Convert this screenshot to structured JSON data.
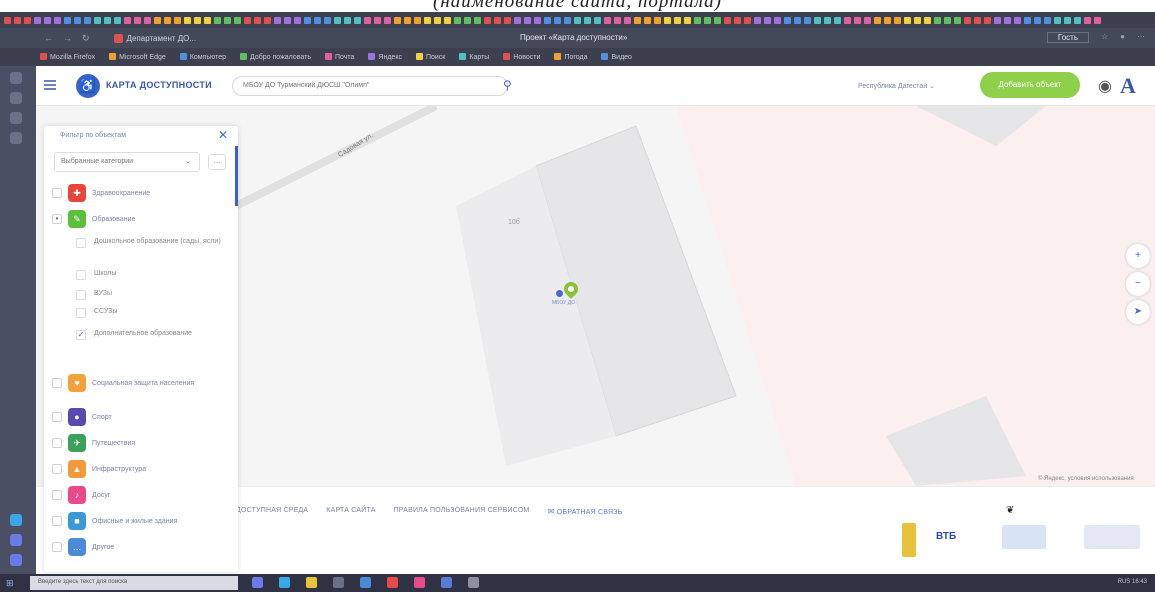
{
  "caption": "(наименование сайта, портала)",
  "browser": {
    "tab_title": "Департамент ДО...",
    "page_title": "Проект «Карта доступности»",
    "profile_label": "Гость",
    "bookmarks": [
      "Mozilla Firefox",
      "Microsoft Edge",
      "Компьютер",
      "Добро пожаловать",
      "Почта",
      "Яндекс",
      "Поиск",
      "Карты",
      "Новости",
      "Погода",
      "Видео"
    ]
  },
  "header": {
    "logo_text": "КАРТА ДОСТУПНОСТИ",
    "search_value": "МБОУ ДО Турманский ДЮСШ \"Олимп\"",
    "region": "Республика Дагестан",
    "add_button": "Добавить объект"
  },
  "map": {
    "street_label": "Садовая ул.",
    "building_number": "10б",
    "poi_label": "МБОУ ДО",
    "copyright": "© Яндекс, условия использования"
  },
  "panel": {
    "title": "Фильтр по объектам",
    "select_value": "Выбранные категории",
    "categories": [
      {
        "label": "Здравоохранение",
        "color": "#e8453c",
        "icon": "✚",
        "checked": false
      },
      {
        "label": "Образование",
        "color": "#5cbf3a",
        "icon": "✎",
        "checked": true
      },
      {
        "label": "Социальная защита населения",
        "color": "#f2a23a",
        "icon": "♥",
        "checked": false
      },
      {
        "label": "Спорт",
        "color": "#5a4ab0",
        "icon": "●",
        "checked": false
      },
      {
        "label": "Путешествия",
        "color": "#3aa05a",
        "icon": "✈",
        "checked": false
      },
      {
        "label": "Инфраструктура",
        "color": "#f29a3a",
        "icon": "▲",
        "checked": false
      },
      {
        "label": "Досуг",
        "color": "#e84a8a",
        "icon": "♪",
        "checked": false
      },
      {
        "label": "Офисные и жилые здания",
        "color": "#3a9ad8",
        "icon": "■",
        "checked": false
      },
      {
        "label": "Другое",
        "color": "#4a8ad8",
        "icon": "…",
        "checked": false
      }
    ],
    "subcategories": [
      {
        "label": "Дошкольное образование (сады, ясли)",
        "checked": false
      },
      {
        "label": "Школы",
        "checked": false
      },
      {
        "label": "ВУЗы",
        "checked": false
      },
      {
        "label": "ССУЗы",
        "checked": false
      },
      {
        "label": "Дополнительное образование",
        "checked": true
      }
    ]
  },
  "footer": {
    "links": [
      "ДОСТУПНАЯ СРЕДА",
      "КАРТА САЙТА",
      "ПРАВИЛА ПОЛЬЗОВАНИЯ СЕРВИСОМ"
    ],
    "feedback": "ОБРАТНАЯ СВЯЗЬ",
    "partners": [
      "ВТБ"
    ]
  },
  "taskbar": {
    "search_placeholder": "Введите здесь текст для поиска",
    "tray": "RUS   16:43"
  }
}
